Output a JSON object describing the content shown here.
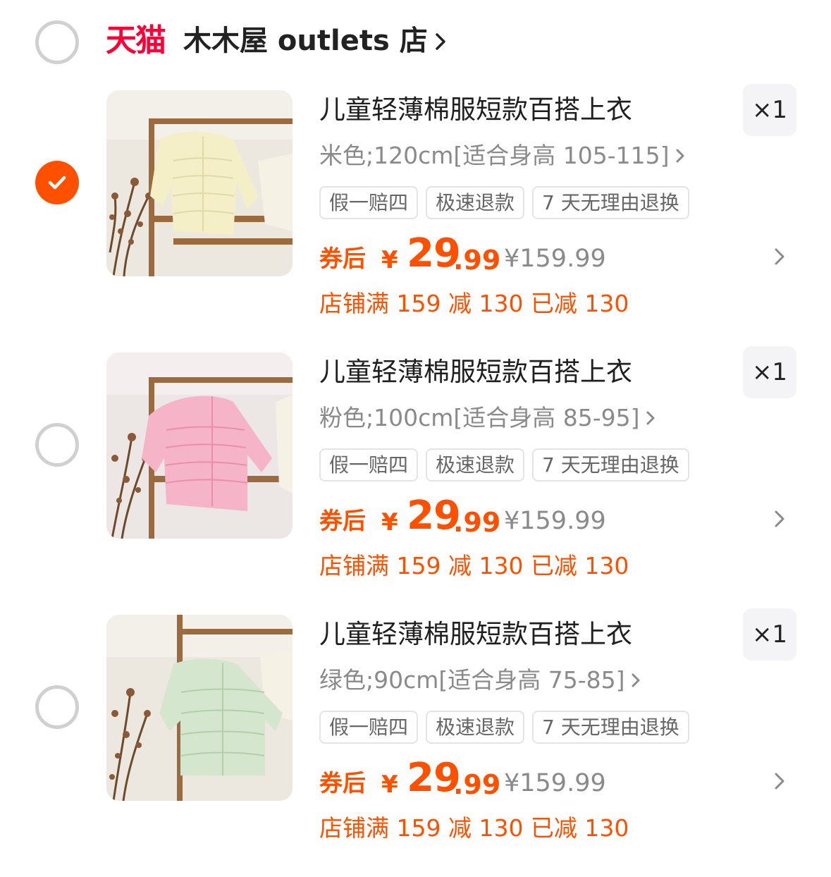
{
  "store": {
    "platform_logo": "天猫",
    "name": "木木屋 outlets 店",
    "selected": false
  },
  "accent_color": "#ff5000",
  "tmall_color": "#ff0036",
  "items": [
    {
      "title": "儿童轻薄棉服短款百搭上衣",
      "spec": "米色;120cm[适合身高 105-115]",
      "tags": [
        "假一赔四",
        "极速退款",
        "7 天无理由退换"
      ],
      "coupon_label": "券后",
      "currency": "¥",
      "price_int": "29",
      "price_dec": ".99",
      "original_price": "¥159.99",
      "promo": "店铺满 159 减 130 已减 130",
      "quantity": "×1",
      "selected": true,
      "jacket_color": "#f4efc6"
    },
    {
      "title": "儿童轻薄棉服短款百搭上衣",
      "spec": "粉色;100cm[适合身高 85-95]",
      "tags": [
        "假一赔四",
        "极速退款",
        "7 天无理由退换"
      ],
      "coupon_label": "券后",
      "currency": "¥",
      "price_int": "29",
      "price_dec": ".99",
      "original_price": "¥159.99",
      "promo": "店铺满 159 减 130 已减 130",
      "quantity": "×1",
      "selected": false,
      "jacket_color": "#f6b4c8"
    },
    {
      "title": "儿童轻薄棉服短款百搭上衣",
      "spec": "绿色;90cm[适合身高 75-85]",
      "tags": [
        "假一赔四",
        "极速退款",
        "7 天无理由退换"
      ],
      "coupon_label": "券后",
      "currency": "¥",
      "price_int": "29",
      "price_dec": ".99",
      "original_price": "¥159.99",
      "promo": "店铺满 159 减 130 已减 130",
      "quantity": "×1",
      "selected": false,
      "jacket_color": "#d5e6cf"
    }
  ]
}
